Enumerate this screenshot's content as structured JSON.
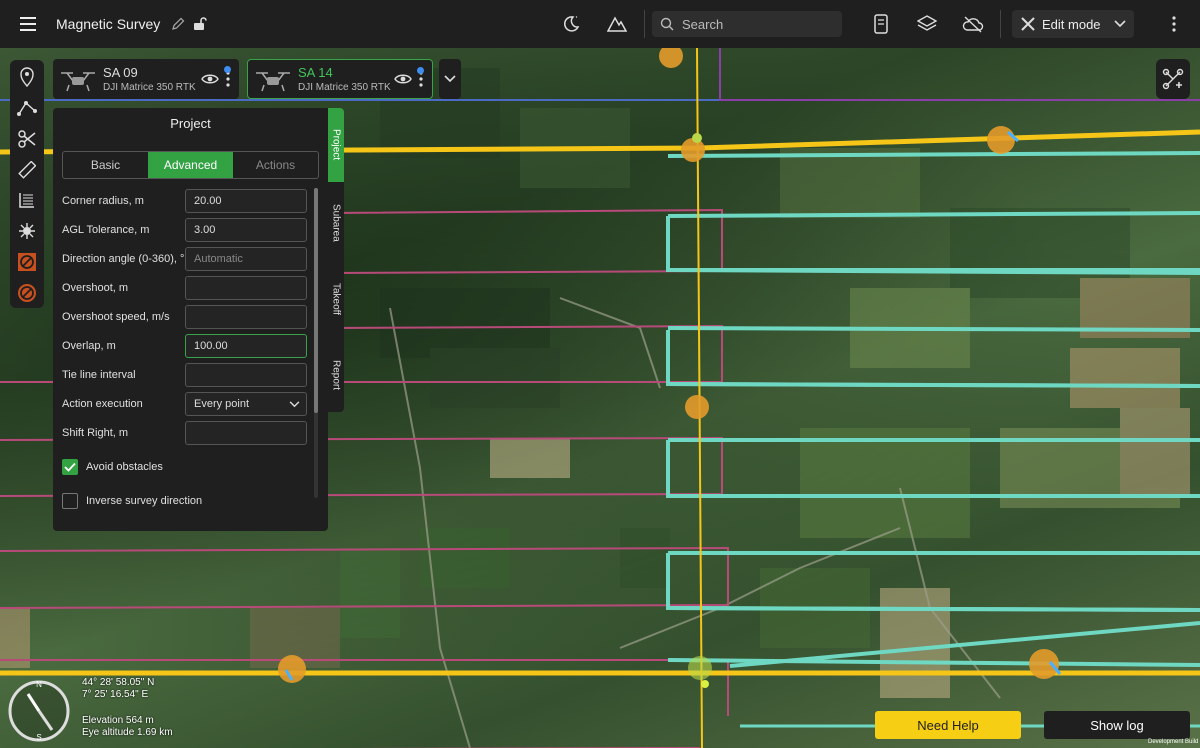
{
  "app": {
    "title": "Magnetic Survey",
    "search_placeholder": "Search",
    "edit_mode_label": "Edit mode"
  },
  "icons": {
    "menu": "hamburger-menu-icon",
    "edit": "pencil-icon",
    "lock": "unlock-icon",
    "center_tools": [
      "moon-night-mode-icon",
      "terrain-mountain-icon",
      "device-tablet-icon",
      "layers-icon",
      "cloud-off-icon"
    ],
    "left_tools": [
      "location-pin-icon",
      "path-waypoints-icon",
      "scissors-icon",
      "ruler-icon",
      "survey-grid-icon",
      "magnet-burst-icon",
      "no-fly-zone-square-icon",
      "no-fly-zone-circle-icon"
    ]
  },
  "drones": [
    {
      "name": "SA 09",
      "model": "DJI Matrice 350 RTK",
      "selected": false
    },
    {
      "name": "SA 14",
      "model": "DJI Matrice 350 RTK",
      "selected": true
    }
  ],
  "panel": {
    "title": "Project",
    "tabs": [
      {
        "label": "Basic",
        "state": "normal"
      },
      {
        "label": "Advanced",
        "state": "active"
      },
      {
        "label": "Actions",
        "state": "disabled"
      }
    ],
    "fields": [
      {
        "label": "Corner radius, m",
        "value": "20.00",
        "placeholder": ""
      },
      {
        "label": "AGL Tolerance, m",
        "value": "3.00",
        "placeholder": ""
      },
      {
        "label": "Direction angle (0-360), °",
        "value": "",
        "placeholder": "Automatic"
      },
      {
        "label": "Overshoot, m",
        "value": "",
        "placeholder": ""
      },
      {
        "label": "Overshoot speed, m/s",
        "value": "",
        "placeholder": ""
      },
      {
        "label": "Overlap, m",
        "value": "100.00",
        "placeholder": ""
      },
      {
        "label": "Tie line interval",
        "value": "",
        "placeholder": ""
      },
      {
        "label": "Action execution",
        "value": "Every point",
        "placeholder": ""
      },
      {
        "label": "Shift Right, m",
        "value": "",
        "placeholder": ""
      }
    ],
    "checkboxes": [
      {
        "label": "Avoid obstacles",
        "checked": true
      },
      {
        "label": "Inverse survey direction",
        "checked": false
      }
    ],
    "side_tabs": [
      "Project",
      "Subarea",
      "Takeoff",
      "Report"
    ]
  },
  "status": {
    "lat": "44° 28' 58.05\" N",
    "lon": "7° 25' 16.54\" E",
    "elevation": "Elevation 564 m",
    "eye_altitude": "Eye altitude 1.69 km",
    "compass_n": "N",
    "compass_s": "S"
  },
  "buttons": {
    "need_help": "Need Help",
    "show_log": "Show log",
    "dev_build": "Development Build"
  },
  "colors": {
    "accent_green": "#33a243",
    "help_yellow": "#f6cf15",
    "flight_cyan": "#6fd4c0",
    "route_pink": "#b14a78",
    "route_yellow": "#f5c518",
    "boundary_purple": "#7b3fa0"
  }
}
